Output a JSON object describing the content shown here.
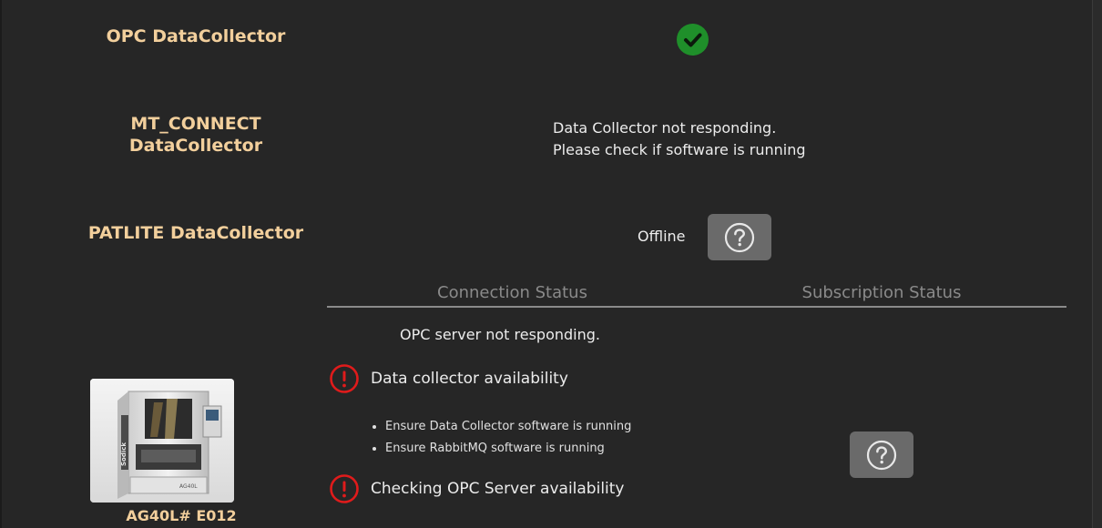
{
  "collectors": {
    "opc": {
      "label": "OPC DataCollector",
      "status": "ok"
    },
    "mt_connect": {
      "label_line1": "MT_CONNECT",
      "label_line2": "DataCollector",
      "message_line1": "Data Collector not responding.",
      "message_line2": "Please check if software is running"
    },
    "patlite": {
      "label": "PATLITE DataCollector",
      "status_text": "Offline"
    }
  },
  "status_table": {
    "connection_header": "Connection Status",
    "subscription_header": "Subscription Status",
    "opc_message": "OPC server not responding.",
    "checks": [
      {
        "label": "Data collector availability",
        "icon": "alert-circle-icon"
      },
      {
        "label": "Checking OPC Server availability",
        "icon": "alert-circle-icon"
      }
    ],
    "hints": [
      "Ensure Data Collector software is running",
      "Ensure RabbitMQ software is running"
    ]
  },
  "machine": {
    "label": "AG40L# E012",
    "brand_text": "Sodick",
    "model_text": "AG40L"
  },
  "colors": {
    "background": "#262626",
    "label_accent": "#f2cf9c",
    "ok_green": "#1f8f2a",
    "alert_red": "#e01b1b",
    "help_button": "#6a6a6a",
    "header_gray": "#8a8a8a"
  }
}
